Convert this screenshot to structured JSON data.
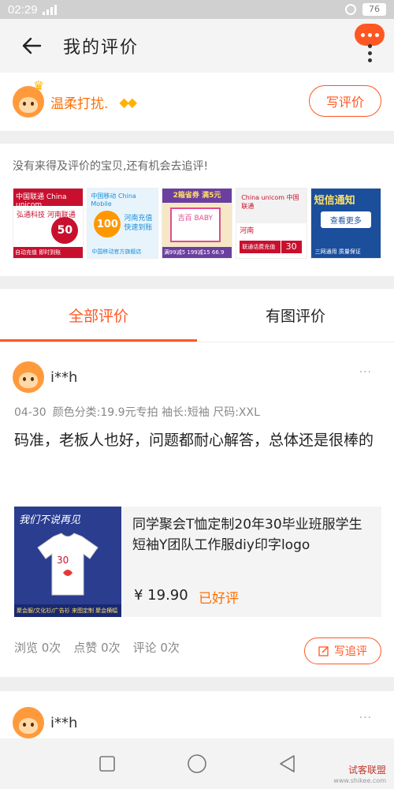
{
  "status_bar": {
    "time": "02:29",
    "battery": "76"
  },
  "header": {
    "title": "我的评价"
  },
  "profile": {
    "name": "温柔打扰.",
    "write_review_label": "写评价"
  },
  "suggest": {
    "text": "没有来得及评价的宝贝,还有机会去追评!",
    "items": [
      {
        "top": "中国联通 China unicom",
        "mid": "弘通科技 河南联通",
        "value": "50",
        "bottom": "自动充值 即时到账"
      },
      {
        "logo": "中国移动 China Mobile",
        "value": "100",
        "text": "河南充值 快速到账",
        "bottom": "中国移动官方旗舰店"
      },
      {
        "top": "2箱省券 满5元",
        "box": "吉百 BABY",
        "bottom": "满99减5 199减15 66.9"
      },
      {
        "top": "China unicom 中国联通",
        "mid": "河南",
        "bar": "联通话费充值",
        "value": "30"
      },
      {
        "top": "短信通知",
        "mid": "查看更多",
        "bottom": "三网通用 质量保证"
      }
    ]
  },
  "tabs": {
    "all": "全部评价",
    "images": "有图评价"
  },
  "review": {
    "user": "i**h",
    "more": "···",
    "date": "04-30",
    "spec": "颜色分类:19.9元专拍 袖长:短袖 尺码:XXL",
    "text": "码准，老板人也好，问题都耐心解答，总体还是很棒的",
    "product": {
      "image_slogan": "我们不说再见",
      "image_strip": "聚会服/文化衫/广告衫 来图定制 聚会横幅",
      "title": "同学聚会T恤定制20年30毕业班服学生短袖Y团队工作服diy印字logo",
      "price": "¥ 19.90",
      "rating": "已好评"
    },
    "stats": {
      "views": "浏览 0次",
      "likes": "点赞 0次",
      "comments": "评论 0次"
    },
    "followup_label": "写追评"
  },
  "review2": {
    "user": "i**h",
    "more": "···"
  },
  "watermark": {
    "main": "试客联盟",
    "sub": "www.shikee.com"
  },
  "colors": {
    "accent": "#ff5722",
    "orange_text": "#ff6f00"
  }
}
